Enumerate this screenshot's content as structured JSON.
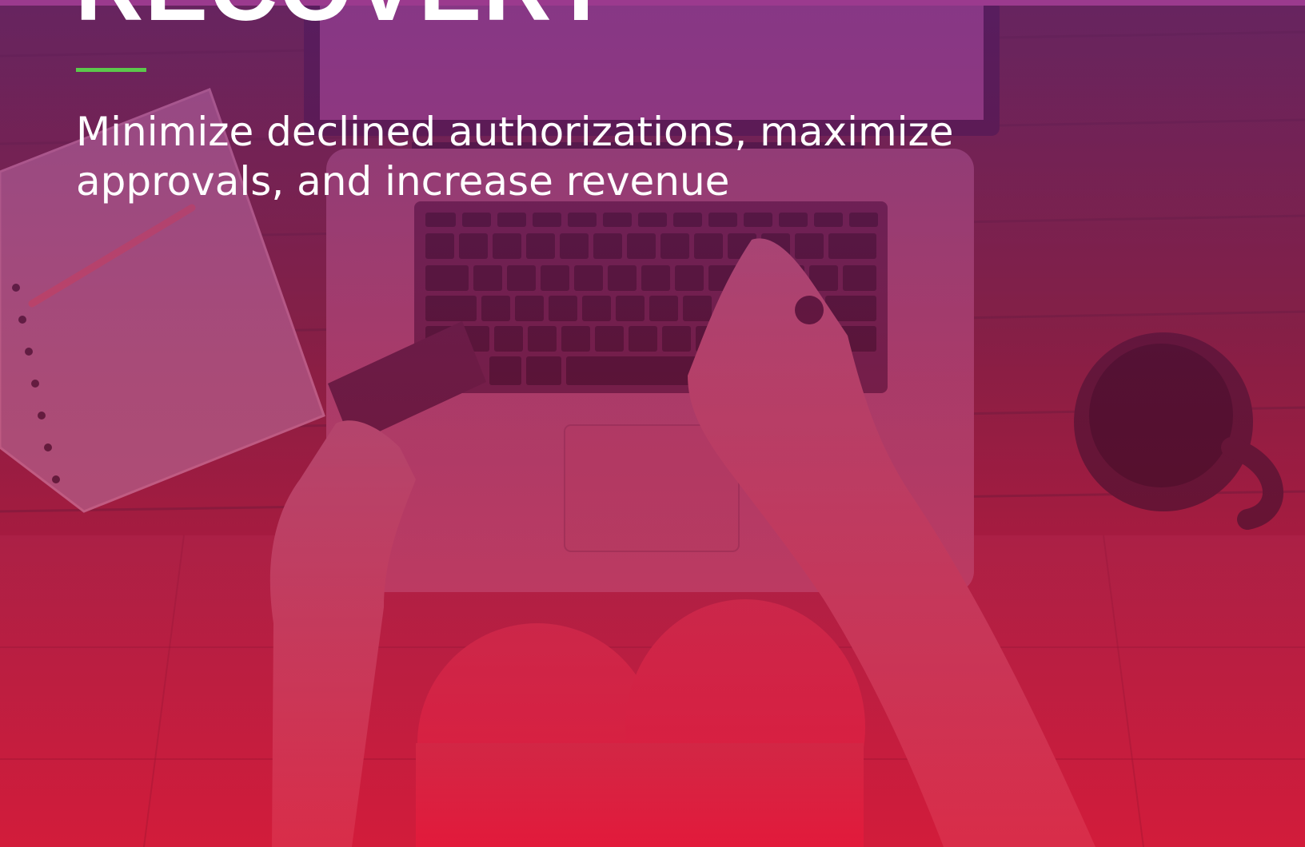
{
  "hero": {
    "headline": "RECOVERY",
    "subtitle": "Minimize declined authorizations, maximize approvals, and increase revenue",
    "photo": "overhead view of a person at a laptop holding a payment card beside a notebook and a coffee mug"
  },
  "colors": {
    "overlay_top": "#702882",
    "overlay_bottom": "#c81432",
    "accent_rule": "#5cc84c",
    "text": "#ffffff"
  }
}
